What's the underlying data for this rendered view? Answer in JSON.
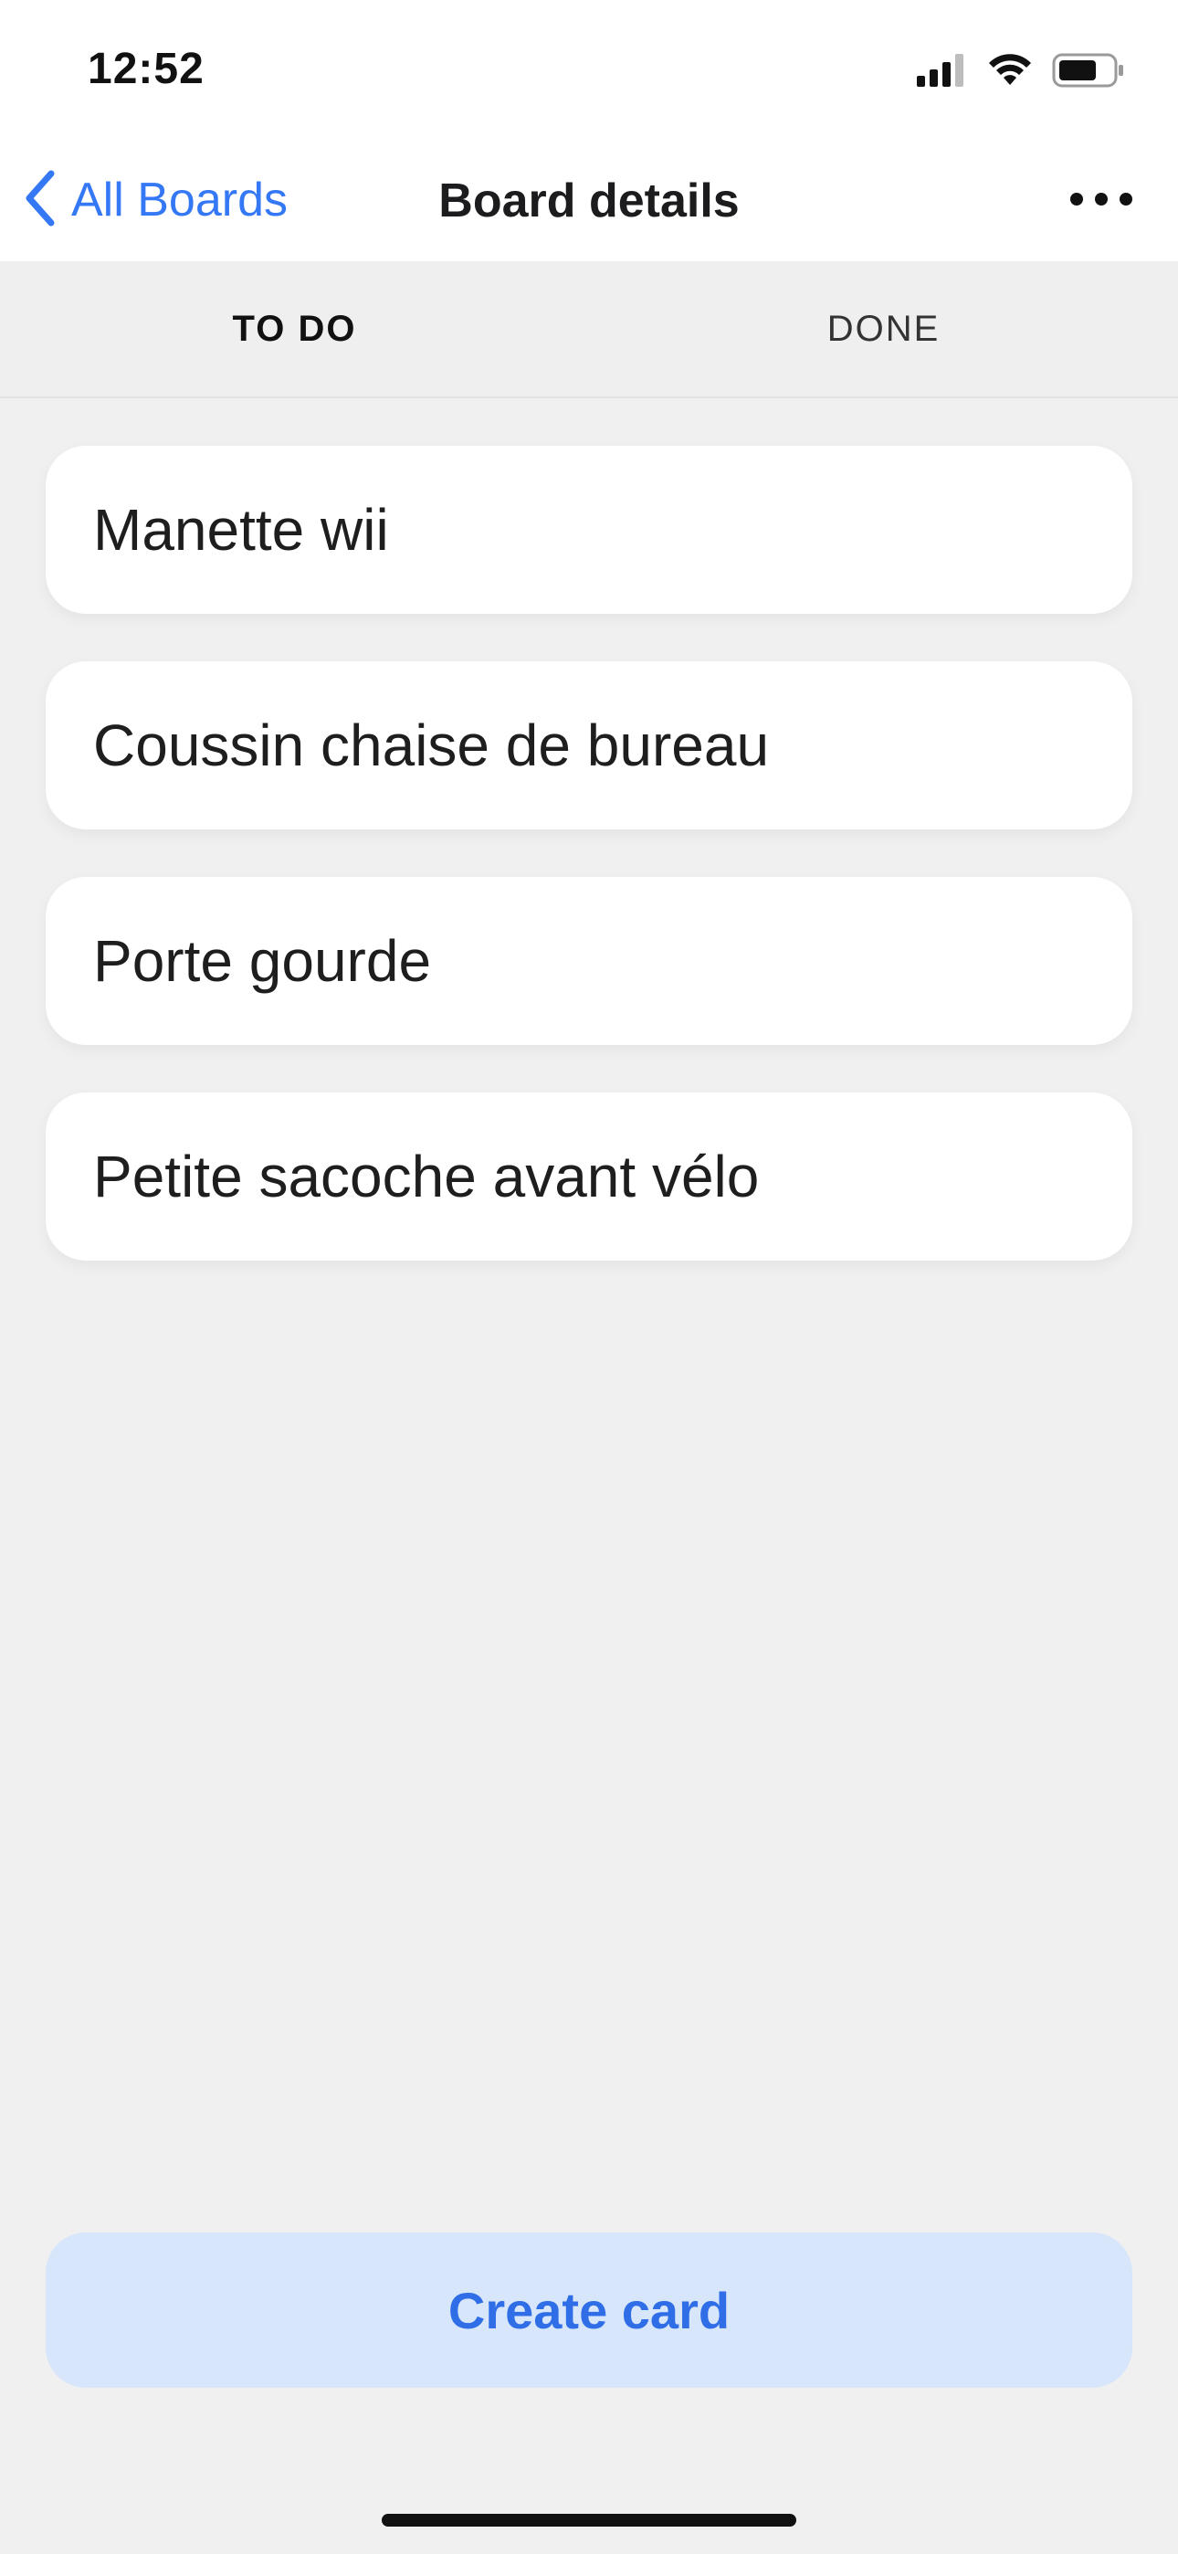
{
  "status_bar": {
    "time": "12:52",
    "icons": [
      "cellular-signal-icon",
      "wifi-icon",
      "battery-icon"
    ]
  },
  "nav": {
    "back_label": "All Boards",
    "title": "Board details",
    "back_icon": "chevron-left-icon",
    "more_icon": "ellipsis-icon"
  },
  "tabs": [
    {
      "label": "TO DO",
      "active": true
    },
    {
      "label": "DONE",
      "active": false
    }
  ],
  "cards": [
    {
      "title": "Manette wii"
    },
    {
      "title": "Coussin chaise de bureau"
    },
    {
      "title": "Porte gourde"
    },
    {
      "title": "Petite sacoche avant vélo"
    }
  ],
  "create_button": {
    "label": "Create card"
  },
  "colors": {
    "accent": "#3478f6",
    "background": "#f0f0f0",
    "create_button_bg": "#d8e6fc"
  }
}
